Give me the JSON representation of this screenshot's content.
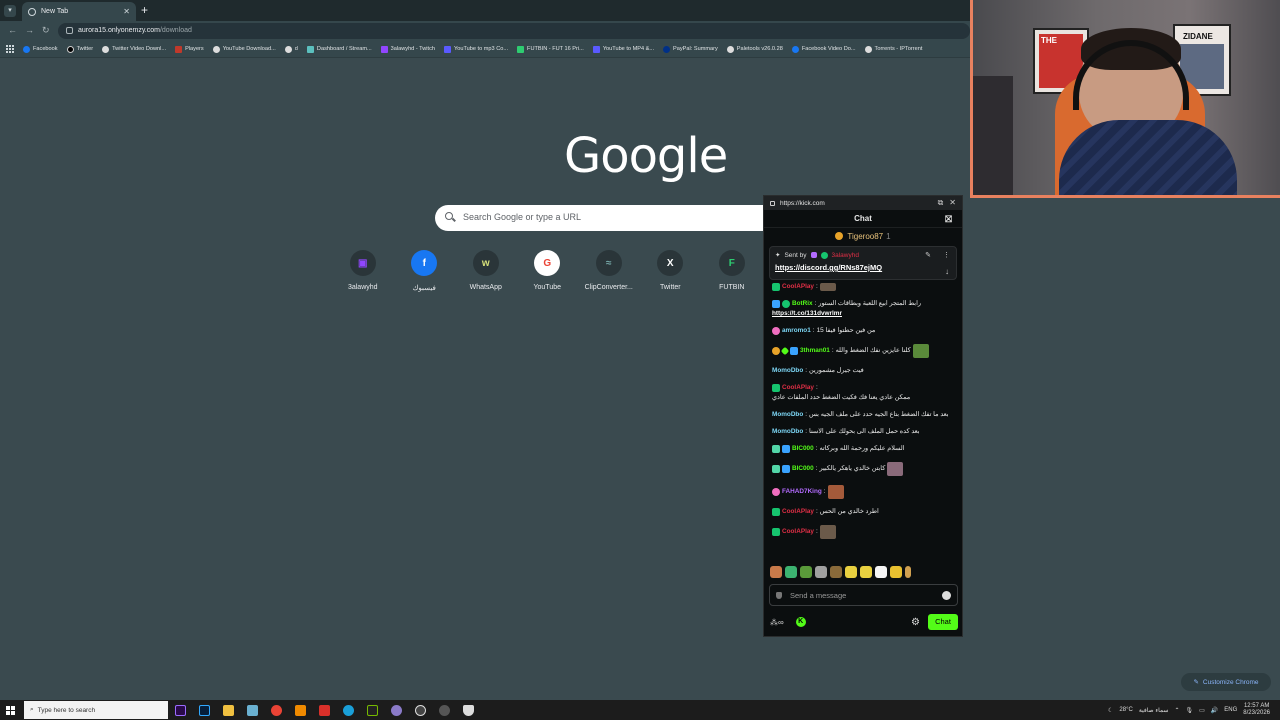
{
  "browser": {
    "tab_title": "New Tab",
    "url_host": "aurora15.onlyonemzy.com",
    "url_path": "/download",
    "bookmarks": [
      {
        "label": "Facebook",
        "color": "#1877f2"
      },
      {
        "label": "Twitter",
        "color": "#e8eaed"
      },
      {
        "label": "Twitter Video Downl...",
        "color": "#e8eaed"
      },
      {
        "label": "Players",
        "color": "#c0392b"
      },
      {
        "label": "YouTube Download...",
        "color": "#e8eaed"
      },
      {
        "label": "d",
        "color": "#e8eaed"
      },
      {
        "label": "Dashboard / Stream...",
        "color": "#9cf"
      },
      {
        "label": "3alawyhd - Twitch",
        "color": "#9146ff"
      },
      {
        "label": "YouTube to mp3 Co...",
        "color": "#5a5aff"
      },
      {
        "label": "FUTBIN - FUT 16 Pri...",
        "color": "#2ecc71"
      },
      {
        "label": "YouTube to MP4 &...",
        "color": "#5a5aff"
      },
      {
        "label": "PayPal: Summary",
        "color": "#003087"
      },
      {
        "label": "Paletools v26.0.28",
        "color": "#e8eaed"
      },
      {
        "label": "Facebook Video Do...",
        "color": "#1877f2"
      },
      {
        "label": "Torrents - IPTorrent",
        "color": "#e8eaed"
      }
    ]
  },
  "ntp": {
    "logo": "Google",
    "search_placeholder": "Search Google or type a URL",
    "shortcuts": [
      {
        "label": "3alawyhd",
        "glyph": "▣",
        "color": "#9146ff"
      },
      {
        "label": "فيسبوك",
        "glyph": "f",
        "color": "#1877f2"
      },
      {
        "label": "WhatsApp",
        "glyph": "w",
        "color": "#7a8a3a"
      },
      {
        "label": "YouTube",
        "glyph": "G",
        "color": "#ea4335"
      },
      {
        "label": "ClipConverter...",
        "glyph": "≈",
        "color": "#7aa"
      },
      {
        "label": "Twitter",
        "glyph": "X",
        "color": "#ffffff"
      },
      {
        "label": "FUTBIN",
        "glyph": "F",
        "color": "#2ecc71"
      }
    ],
    "customize_label": "Customize Chrome"
  },
  "webcam": {
    "poster_left_text": "THE",
    "poster_right_text": "ZIDANE"
  },
  "kick": {
    "url": "https://kick.com",
    "header": "Chat",
    "top_gifter": "Tigeroo87",
    "top_gifter_count": "1",
    "pinned_label": "Sent by",
    "pinned_user": "3alawyhd",
    "pinned_link": "https://discord.gg/RNs87ejMQ",
    "messages": [
      {
        "user": "CoolAPlay",
        "color": "#e02f46",
        "text": "",
        "badge": "#16c46e",
        "emote": "#6b5a4a"
      },
      {
        "user": "BotRix",
        "color": "#53fc18",
        "text": "رابط المتجر ابيع اللعبة وبطاقات الستور",
        "link": "https://t.co/131dvwrlmr",
        "badge": "#3aa3ff"
      },
      {
        "user": "amromo1",
        "color": "#7dd6f5",
        "text": "من فين حطتوا فيفا 15",
        "badge": "#f06ec0"
      },
      {
        "user": "3thman01",
        "color": "#53fc18",
        "text": "كلنا عايزين نفك الضغط والله",
        "badge": "#e8a329",
        "emote": "#5a8a3a"
      },
      {
        "user": "MomoDbo",
        "color": "#7dd6f5",
        "text": "فيت جيرل مشمورين"
      },
      {
        "user": "CoolAPlay",
        "color": "#e02f46",
        "text": "ممكن عادي يعنا فك فكيت الضغط حدد الملفات عادي",
        "badge": "#16c46e"
      },
      {
        "user": "MomoDbo",
        "color": "#7dd6f5",
        "text": "بعد ما تفك الضغط بتاع الجيه حدد على ملف الجيه بس"
      },
      {
        "user": "MomoDbo",
        "color": "#7dd6f5",
        "text": "بعد كده حمل الملف الى بحولك على الاسنا"
      },
      {
        "user": "BIC000",
        "color": "#53fc18",
        "text": "السلام عليكم ورحمة الله وبركاته",
        "badge": "#3aa3ff"
      },
      {
        "user": "BIC000",
        "color": "#53fc18",
        "text": "كابتن خالدي ياهكر يالكبير",
        "badge": "#3aa3ff",
        "emote": "#8a6a7a"
      },
      {
        "user": "FAHAD7King",
        "color": "#b36bff",
        "text": "",
        "badge": "#f06ec0",
        "emote": "#a45a3a"
      },
      {
        "user": "CoolAPlay",
        "color": "#e02f46",
        "text": "اطرد خالدي من الحس",
        "badge": "#16c46e"
      },
      {
        "user": "CoolAPlay",
        "color": "#e02f46",
        "text": "",
        "badge": "#16c46e",
        "emote": "#6b5a4a"
      }
    ],
    "input_placeholder": "Send a message",
    "chat_button": "Chat",
    "emote_colors": [
      "#c97a4a",
      "#3cb371",
      "#5a9a3a",
      "#a0a0a0",
      "#8a6a3a",
      "#e8d040",
      "#e8d040",
      "#f5f5f5",
      "#e8c030",
      "#d0a050"
    ]
  },
  "taskbar": {
    "search_placeholder": "Type here to search",
    "weather": "28°C",
    "weather_text": "سماء صافية",
    "lang": "ENG",
    "time": "12:57 AM",
    "date": "8/23/2026"
  }
}
